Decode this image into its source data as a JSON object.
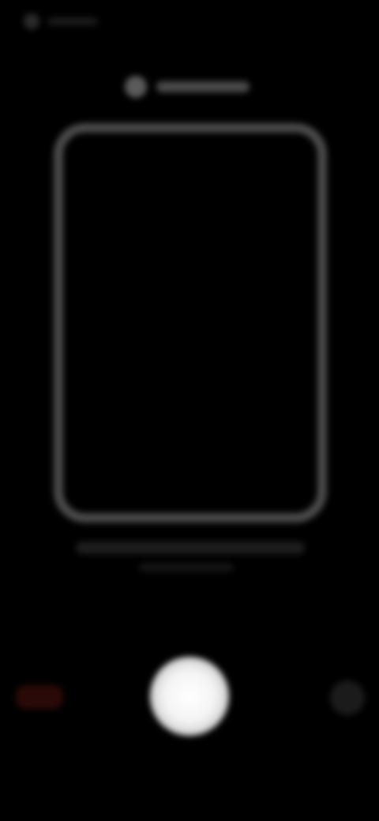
{
  "colors": {
    "background": "#000000",
    "frame_stroke": "#4b4b4b",
    "shutter": "#ffffff",
    "left_control": "#2a0a08",
    "right_control": "#1b1b1b"
  },
  "icons": {
    "top_left": "back-icon",
    "hint": "info-icon",
    "shutter": "shutter-icon",
    "left": "flash-icon",
    "right": "flip-camera-icon"
  }
}
